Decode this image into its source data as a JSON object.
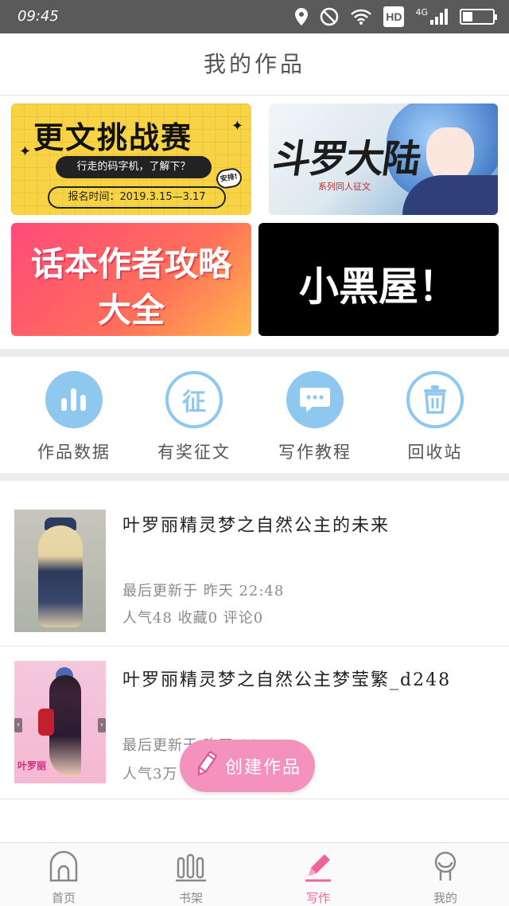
{
  "status_bar": {
    "time": "09:45",
    "icons": [
      "location-icon",
      "do-not-disturb-icon",
      "wifi-icon",
      "hd-badge",
      "signal-icon",
      "battery-icon"
    ],
    "hd_label": "HD",
    "network_label": "4G"
  },
  "header": {
    "title": "我的作品"
  },
  "banners": {
    "contest": {
      "heading": "更文挑战赛",
      "tagline": "行走的码字机，了解下？",
      "stamp": "安排!",
      "date": "报名时间：2019.3.15—3.17"
    },
    "douluo": {
      "title": "斗罗大陆",
      "subtitle": "系列同人征文"
    },
    "guide": {
      "line1": "话本作者攻略",
      "line2": "大全"
    },
    "blackroom": {
      "text": "小黑屋！"
    }
  },
  "quick_actions": [
    {
      "label": "作品数据",
      "icon": "bar-chart-icon"
    },
    {
      "label": "有奖征文",
      "icon": "zheng-character-icon",
      "glyph": "征"
    },
    {
      "label": "写作教程",
      "icon": "chat-bubble-icon"
    },
    {
      "label": "回收站",
      "icon": "trash-icon"
    }
  ],
  "works": [
    {
      "title": "叶罗丽精灵梦之自然公主的未来",
      "updated": "最后更新于 昨天 22:48",
      "stats": "人气48 收藏0 评论0"
    },
    {
      "title": "叶罗丽精灵梦之自然公主梦莹繁_d248",
      "updated": "最后更新于 昨天 11:30",
      "stats": "人气3万",
      "cover_logo": "叶罗丽"
    }
  ],
  "fab": {
    "label": "创建作品",
    "icon": "pencil-icon"
  },
  "tab_bar": {
    "tabs": [
      {
        "label": "首页",
        "icon": "home-icon"
      },
      {
        "label": "书架",
        "icon": "bookshelf-icon"
      },
      {
        "label": "写作",
        "icon": "pen-icon"
      },
      {
        "label": "我的",
        "icon": "profile-icon"
      }
    ],
    "active_index": 2
  },
  "colors": {
    "accent_pink": "#f2639e",
    "fab_pink": "#f591bd",
    "action_blue": "#8ec8ee",
    "status_bar": "#5a5a5a"
  }
}
